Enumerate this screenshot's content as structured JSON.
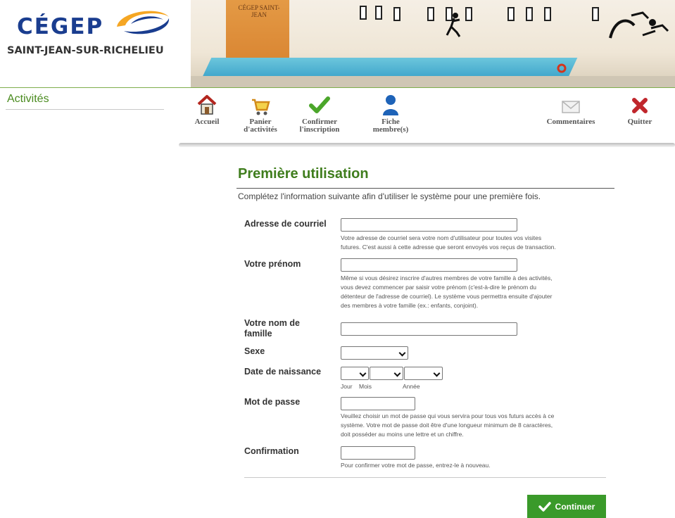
{
  "logo": {
    "name": "CÉGEP",
    "subtitle": "SAINT-JEAN-SUR-RICHELIEU"
  },
  "banner": {
    "sign": "CÉGEP SAINT-JEAN"
  },
  "sidebar": {
    "title": "Activités"
  },
  "toolbar": {
    "items": [
      {
        "label_line1": "Accueil",
        "label_line2": "",
        "icon": "home-icon"
      },
      {
        "label_line1": "Panier",
        "label_line2": "d'activités",
        "icon": "cart-icon"
      },
      {
        "label_line1": "Confirmer",
        "label_line2": "l'inscription",
        "icon": "checkmark-icon"
      },
      {
        "label_line1": "Fiche",
        "label_line2": "membre(s)",
        "icon": "member-icon"
      },
      {
        "label_line1": "Commentaires",
        "label_line2": "",
        "icon": "envelope-icon"
      },
      {
        "label_line1": "Quitter",
        "label_line2": "",
        "icon": "close-icon"
      }
    ]
  },
  "form": {
    "title": "Première utilisation",
    "intro": "Complétez l'information suivante afin d'utiliser le système pour une première fois.",
    "email_label": "Adresse de courriel",
    "email_value": "",
    "email_help_1": "Votre adresse de courriel sera votre nom d'utilisateur pour toutes vos visites",
    "email_help_2": "futures. C'est aussi à cette adresse que seront envoyés vos reçus de transaction.",
    "firstname_label": "Votre prénom",
    "firstname_value": "",
    "firstname_help_1": "Même si vous désirez inscrire d'autres membres de votre famille à des activités,",
    "firstname_help_2": "vous devez commencer par saisir votre prénom (c'est-à-dire le prénom du",
    "firstname_help_3": "détenteur de l'adresse de courriel). Le système vous permettra ensuite d'ajouter",
    "firstname_help_4": "des membres à votre famille (ex.: enfants, conjoint).",
    "lastname_label_1": "Votre nom de",
    "lastname_label_2": "famille",
    "lastname_value": "",
    "sex_label": "Sexe",
    "sex_value": "",
    "birth_label": "Date de naissance",
    "birth_day_value": "",
    "birth_month_value": "",
    "birth_year_value": "",
    "birth_day_caption": "Jour",
    "birth_month_caption": "Mois",
    "birth_year_caption": "Année",
    "password_label": "Mot de passe",
    "password_value": "",
    "password_help_1": "Veuillez choisir un mot de passe qui vous servira pour tous vos futurs accès à ce",
    "password_help_2": "système. Votre mot de passe doit être d'une longueur minimum de 8 caractères,",
    "password_help_3": "doit posséder au moins une lettre et un chiffre.",
    "confirm_label": "Confirmation",
    "confirm_value": "",
    "confirm_help": "Pour confirmer votre mot de passe, entrez-le à nouveau.",
    "continue_label": "Continuer"
  },
  "colors": {
    "brand_blue": "#1a3d8f",
    "brand_orange": "#f5a623",
    "title_green": "#3f7d1d",
    "button_green": "#3a9a2a",
    "quit_red": "#c0262c"
  }
}
